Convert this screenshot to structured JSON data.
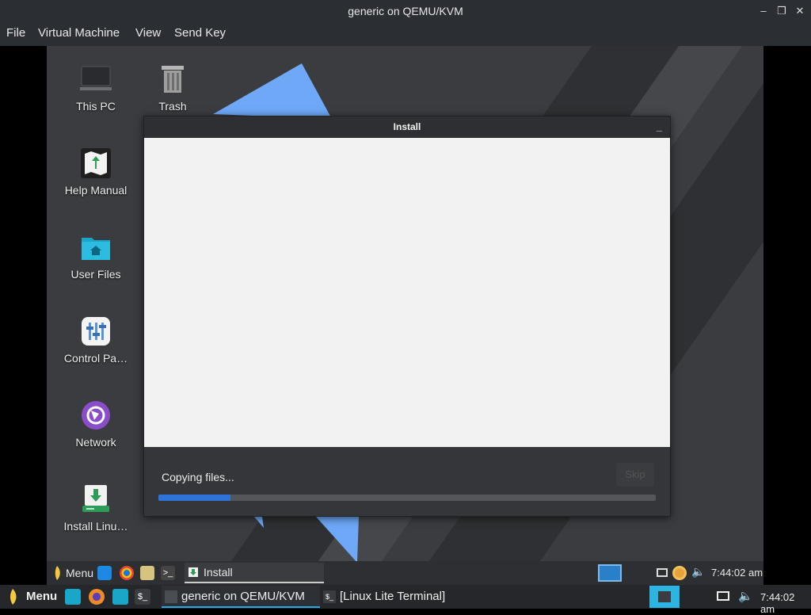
{
  "host": {
    "window_title": "generic on QEMU/KVM",
    "menu": [
      "File",
      "Virtual Machine",
      "View",
      "Send Key"
    ],
    "taskbar": {
      "menu_label": "Menu",
      "tasks": [
        "generic on QEMU/KVM",
        "[Linux Lite Terminal]"
      ],
      "clock": "7:44:02 am"
    }
  },
  "guest": {
    "desktop_icons": [
      {
        "label": "This PC",
        "icon": "monitor-icon"
      },
      {
        "label": "Trash",
        "icon": "trash-icon"
      },
      {
        "label": "Help Manual",
        "icon": "help-manual-icon"
      },
      {
        "label": "User Files",
        "icon": "home-folder-icon"
      },
      {
        "label": "Control Pa…",
        "icon": "control-panel-icon"
      },
      {
        "label": "Network",
        "icon": "network-icon"
      },
      {
        "label": "Install Linu…",
        "icon": "install-icon"
      }
    ],
    "install_dialog": {
      "title": "Install",
      "minimize": "_",
      "status": "Copying files...",
      "skip_label": "Skip",
      "progress_fraction": 0.145
    },
    "taskbar": {
      "menu_label": "Menu",
      "task_label": "Install",
      "clock": "7:44:02 am"
    }
  },
  "colors": {
    "accent_blue": "#2f72d8",
    "active_task": "#2aa8e0",
    "chrome_dark": "#2b2e33"
  }
}
